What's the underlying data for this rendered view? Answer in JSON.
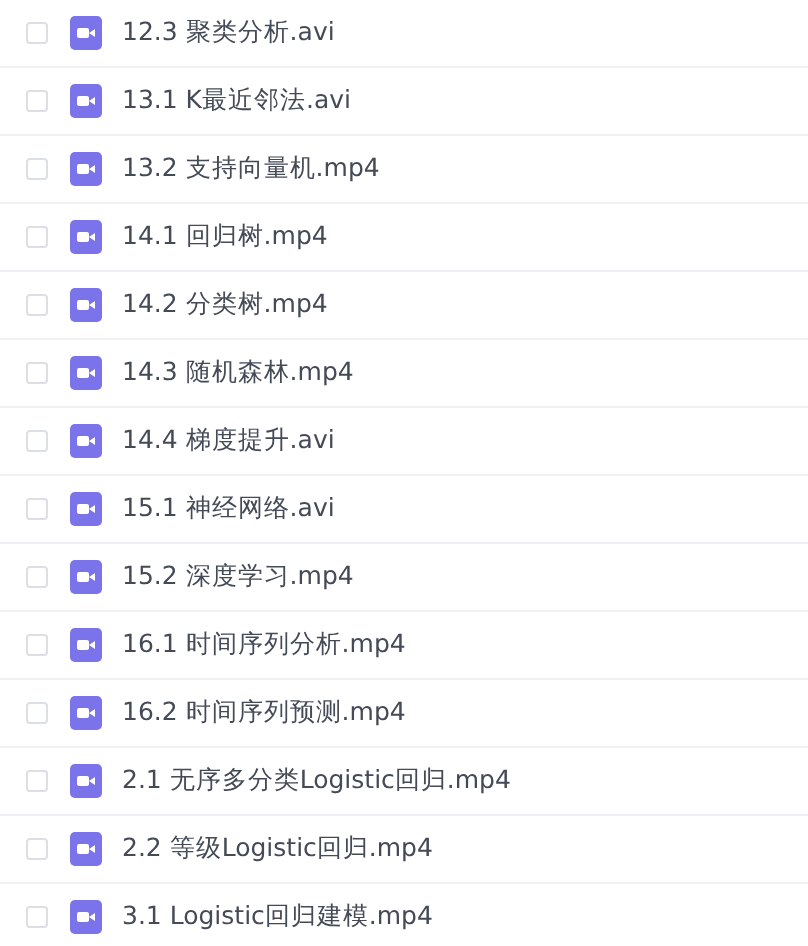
{
  "files": [
    {
      "name": "12.3 聚类分析.avi",
      "checked": false
    },
    {
      "name": "13.1 K最近邻法.avi",
      "checked": false
    },
    {
      "name": "13.2 支持向量机.mp4",
      "checked": false
    },
    {
      "name": "14.1 回归树.mp4",
      "checked": false
    },
    {
      "name": "14.2 分类树.mp4",
      "checked": false
    },
    {
      "name": "14.3 随机森林.mp4",
      "checked": false
    },
    {
      "name": "14.4 梯度提升.avi",
      "checked": false
    },
    {
      "name": "15.1 神经网络.avi",
      "checked": false
    },
    {
      "name": "15.2 深度学习.mp4",
      "checked": false
    },
    {
      "name": "16.1 时间序列分析.mp4",
      "checked": false
    },
    {
      "name": "16.2 时间序列预测.mp4",
      "checked": false
    },
    {
      "name": "2.1 无序多分类Logistic回归.mp4",
      "checked": false
    },
    {
      "name": "2.2 等级Logistic回归.mp4",
      "checked": false
    },
    {
      "name": "3.1 Logistic回归建模.mp4",
      "checked": false
    }
  ]
}
